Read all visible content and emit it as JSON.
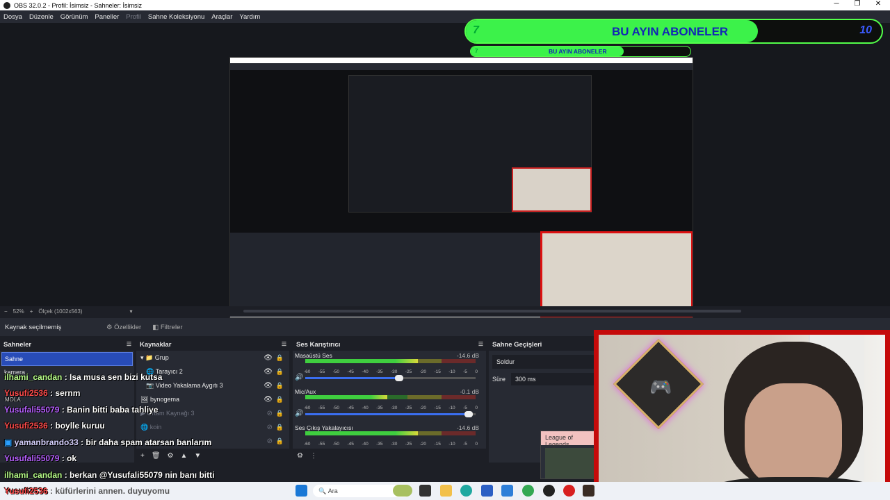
{
  "window": {
    "title": "OBS 32.0.2 - Profil: İsimsiz - Sahneler: İsimsiz",
    "minimize": "─",
    "restore": "❐",
    "close": "✕"
  },
  "menu": [
    "Dosya",
    "Düzenle",
    "Görünüm",
    "Paneller",
    "Profil",
    "Sahne Koleksiyonu",
    "Araçlar",
    "Yardım"
  ],
  "overlay": {
    "banner_left_number": "7",
    "banner_title": "BU AYIN ABONELER",
    "banner_right_number": "10",
    "banner2_number": "7",
    "banner2_title": "BU AYIN ABONELER"
  },
  "zoom": {
    "percent": "52%",
    "plus": "+",
    "minus": "−",
    "scale": "Ölçek (1002x563)",
    "chevron": "▾"
  },
  "properties_bar": {
    "selection": "Kaynak seçilmemiş",
    "properties": "Özellikler",
    "filters": "Filtreler"
  },
  "scenes": {
    "title": "Sahneler",
    "items": [
      "Sahne",
      "kamera"
    ]
  },
  "sources": {
    "title": "Kaynaklar",
    "items": [
      {
        "label": "Grup",
        "icon": "▾ 📁",
        "hidden": false
      },
      {
        "label": "Tarayıcı 2",
        "icon": "🌐",
        "hidden": false
      },
      {
        "label": "Video Yakalama Aygıtı 3",
        "icon": "📷",
        "hidden": false
      },
      {
        "label": "bynogema",
        "icon": "🖼",
        "hidden": false
      },
      {
        "label": "Ortam Kaynağı 3",
        "icon": "▶",
        "hidden": true
      },
      {
        "label": "koin",
        "icon": "🌐",
        "hidden": true
      },
      {
        "label": "",
        "icon": "",
        "hidden": true
      }
    ],
    "toolbar": [
      "+",
      "🗑",
      "⚙",
      "▲",
      "▼"
    ]
  },
  "mixer": {
    "title": "Ses Karıştırıcı",
    "tracks": [
      {
        "name": "Masaüstü Ses",
        "db": "-14.6 dB",
        "level": 0.66,
        "volume": 0.55
      },
      {
        "name": "Mic/Aux",
        "db": "-0.1 dB",
        "level": 0.48,
        "volume": 0.96
      },
      {
        "name": "Ses Çıkış Yakalayıcısı",
        "db": "-14.6 dB",
        "level": 0.66,
        "volume": 0.55
      }
    ],
    "ticks": [
      "-60",
      "-55",
      "-50",
      "-45",
      "-40",
      "-35",
      "-30",
      "-25",
      "-20",
      "-15",
      "-10",
      "-5",
      "0"
    ]
  },
  "transitions": {
    "title": "Sahne Geçişleri",
    "type": "Soldur",
    "duration_label": "Süre",
    "duration_value": "300 ms"
  },
  "chat": [
    {
      "user": "ilhami_candan",
      "msg": " : Isa musa sen bizi kutsa",
      "color": "u1"
    },
    {
      "user": "Yusufi2536",
      "msg": " : sernm",
      "color": "u2"
    },
    {
      "user": "Yusufali55079",
      "msg": " : Banin bitti baba tahliye",
      "color": "u3"
    },
    {
      "user": "Yusufi2536",
      "msg": " : boylle kuruu",
      "color": "u2"
    },
    {
      "user": "yamanbrando33",
      "msg": " : bir daha spam atarsan banlarım",
      "color": "u4"
    },
    {
      "user": "Yusufali55079",
      "msg": " : ok",
      "color": "u3"
    },
    {
      "user": "ilhami_candan",
      "msg": " : berkan @Yusufali55079 nin banı bitti",
      "color": "u1"
    },
    {
      "user": "Yusufi2536",
      "msg": " : küfürlerini annen. duyuyomu",
      "color": "u2"
    }
  ],
  "chat_small": "MOLA",
  "lol_card": "League of Legends",
  "taskbar": {
    "search": "Ara"
  }
}
